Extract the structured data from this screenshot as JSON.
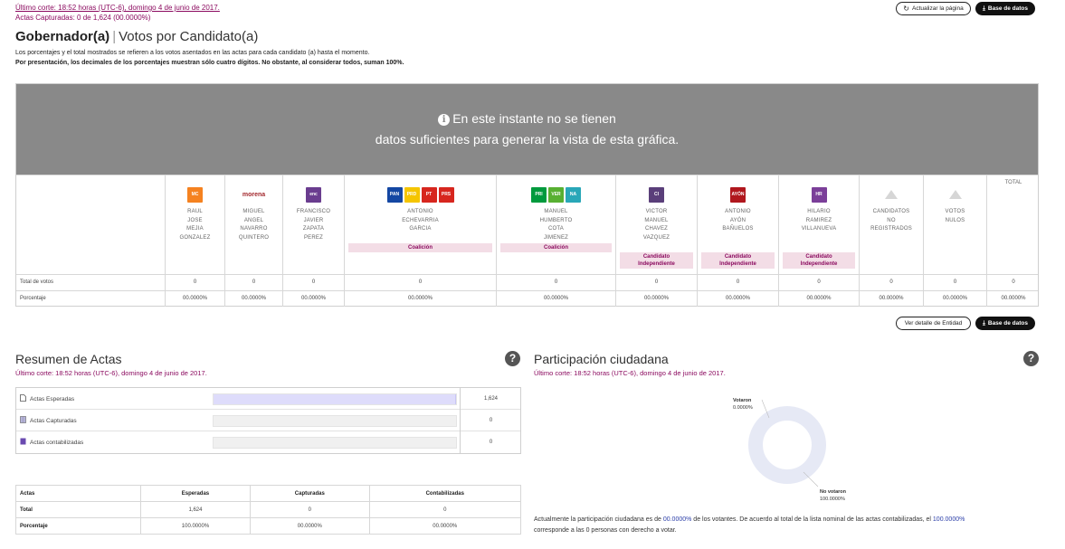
{
  "header": {
    "last_cut": "Último corte: 18:52 horas (UTC-6), domingo 4 de junio de 2017.",
    "captured": "Actas Capturadas: 0 de 1,624 (00.0000%)",
    "refresh_label": "Actualizar la página",
    "db_label": "Base de datos"
  },
  "title": {
    "main": "Gobernador(a)",
    "sep": "|",
    "sub": "Votos por Candidato(a)"
  },
  "description": {
    "line1": "Los porcentajes y el total mostrados se refieren a los votos asentados en las actas para cada candidato (a) hasta el momento.",
    "line2": "Por presentación, los decimales de los porcentajes muestran sólo cuatro dígitos. No obstante, al considerar todos, suman 100%."
  },
  "banner": {
    "line1": "En este instante no se tienen",
    "line2": "datos suficientes para generar la vista de esta gráfica."
  },
  "table": {
    "row_votes": "Total de votos",
    "row_pct": "Porcentaje",
    "total_header": "TOTAL",
    "columns": [
      {
        "name": "RAUL\nJOSE\nMEJIA\nGONZALEZ",
        "party": "MC",
        "logos": [
          {
            "txt": "MC",
            "color": "#f58220"
          }
        ],
        "votes": "0",
        "pct": "00.0000%",
        "badge": ""
      },
      {
        "name": "MIGUEL\nANGEL\nNAVARRO\nQUINTERO",
        "party": "morena",
        "logos": [
          {
            "txt": "morena",
            "color": "#a3282d"
          }
        ],
        "votes": "0",
        "pct": "00.0000%",
        "badge": ""
      },
      {
        "name": "FRANCISCO\nJAVIER\nZAPATA\nPEREZ",
        "party": "encuentro social",
        "logos": [
          {
            "txt": "encuentro social",
            "color": "#6a3d8f"
          }
        ],
        "votes": "0",
        "pct": "00.0000%",
        "badge": ""
      },
      {
        "name": "ANTONIO\nECHEVARRIA\nGARCIA",
        "party": "coalicion",
        "logos": [
          {
            "txt": "PAN",
            "color": "#1447a3"
          },
          {
            "txt": "PRD",
            "color": "#f5c500"
          },
          {
            "txt": "PT",
            "color": "#d7261e"
          },
          {
            "txt": "PRS",
            "color": "#d7261e"
          }
        ],
        "votes": "0",
        "pct": "00.0000%",
        "badge": "Coalición"
      },
      {
        "name": "MANUEL\nHUMBERTO\nCOTA\nJIMENEZ",
        "party": "coalicion",
        "logos": [
          {
            "txt": "PRI",
            "color": "#009a3d"
          },
          {
            "txt": "VERDE",
            "color": "#58b032"
          },
          {
            "txt": "NA",
            "color": "#29a7b8"
          }
        ],
        "votes": "0",
        "pct": "00.0000%",
        "badge": "Coalición"
      },
      {
        "name": "VICTOR\nMANUEL\nCHAVEZ\nVAZQUEZ",
        "party": "independiente",
        "logos": [
          {
            "txt": "CI",
            "color": "#5a3f7a"
          }
        ],
        "votes": "0",
        "pct": "00.0000%",
        "badge": "Candidato\nIndependiente"
      },
      {
        "name": "ANTONIO\nAYÓN\nBAÑUELOS",
        "party": "independiente",
        "logos": [
          {
            "txt": "AYÓN",
            "color": "#b0171d"
          }
        ],
        "votes": "0",
        "pct": "00.0000%",
        "badge": "Candidato\nIndependiente"
      },
      {
        "name": "HILARIO\nRAMIREZ\nVILLANUEVA",
        "party": "independiente",
        "logos": [
          {
            "txt": "HR",
            "color": "#7b3f99"
          }
        ],
        "votes": "0",
        "pct": "00.0000%",
        "badge": "Candidato\nIndependiente"
      },
      {
        "name": "CANDIDATOS\nNO\nREGISTRADOS",
        "party": "none",
        "logos": [
          {
            "txt": "",
            "color": "#cfcfcf"
          }
        ],
        "votes": "0",
        "pct": "00.0000%",
        "badge": ""
      },
      {
        "name": "VOTOS\nNULOS",
        "party": "none",
        "logos": [
          {
            "txt": "",
            "color": "#cfcfcf"
          }
        ],
        "votes": "0",
        "pct": "00.0000%",
        "badge": ""
      },
      {
        "name": "",
        "party": "total",
        "logos": [],
        "votes": "0",
        "pct": "00.0000%",
        "badge": ""
      }
    ]
  },
  "buttons": {
    "detail_label": "Ver detalle de Entidad",
    "db_label": "Base de datos"
  },
  "resumen": {
    "title": "Resumen de Actas",
    "last_cut": "Último corte: 18:52 horas (UTC-6), domingo 4 de junio de 2017.",
    "bars": [
      {
        "label": "Actas Esperadas",
        "value": "1,624",
        "fill": 1.0
      },
      {
        "label": "Actas Capturadas",
        "value": "0",
        "fill": 0
      },
      {
        "label": "Actas contabilizadas",
        "value": "0",
        "fill": 0
      }
    ],
    "table": {
      "headers": [
        "Actas",
        "Esperadas",
        "Capturadas",
        "Contabilizadas"
      ],
      "rows": [
        [
          "Total",
          "1,624",
          "0",
          "0"
        ],
        [
          "Porcentaje",
          "100.0000%",
          "00.0000%",
          "00.0000%"
        ]
      ]
    }
  },
  "participacion": {
    "title": "Participación ciudadana",
    "last_cut": "Último corte: 18:52 horas (UTC-6), domingo 4 de junio de 2017.",
    "votaron_label": "Votaron",
    "votaron_value": "0.0000%",
    "no_votaron_label": "No votaron",
    "no_votaron_value": "100.0000%",
    "text_a": "Actualmente la participación ciudadana es de ",
    "pct1": "00.0000%",
    "text_b": " de los votantes. De acuerdo al total de la lista nominal de las actas contabilizadas, el ",
    "pct2": "100.0000%",
    "text_c": "corresponde a las 0 personas con derecho a votar.",
    "donut_color": "#e6e9f5"
  }
}
